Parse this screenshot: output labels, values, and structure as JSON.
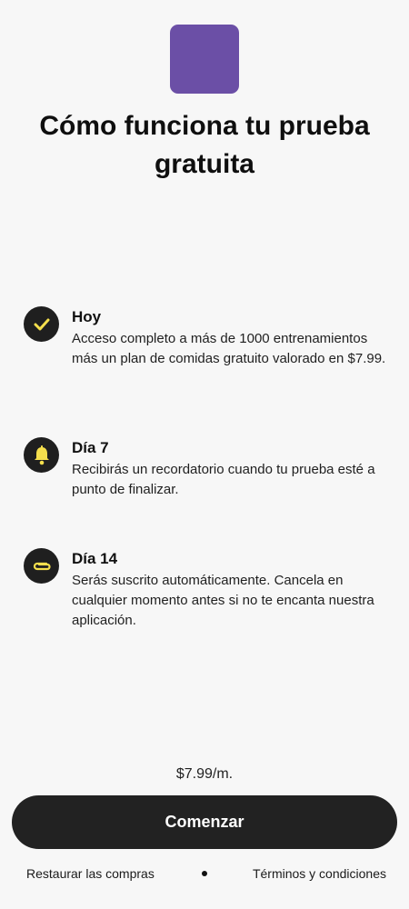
{
  "header": {
    "logo_color": "#6b4fa6",
    "title": "Cómo funciona tu prueba gratuita"
  },
  "timeline": [
    {
      "title": "Hoy",
      "text": "Acceso completo a más de 1000 entrenamientos más un plan de comidas gratuito valorado en $7.99.",
      "icon": "check-icon"
    },
    {
      "title": "Día 7",
      "text": "Recibirás un recordatorio cuando tu prueba esté a punto de finalizar.",
      "icon": "bell-icon"
    },
    {
      "title": "Día 14",
      "text": "Serás suscrito automáticamente. Cancela en cualquier momento antes si no te encanta nuestra aplicación.",
      "icon": "paperclip-icon"
    }
  ],
  "pricing": {
    "price": "$7.99/m."
  },
  "cta": {
    "label": "Comenzar"
  },
  "footer": {
    "restore_label": "Restaurar las compras",
    "terms_label": "Términos y condiciones"
  },
  "colors": {
    "accent_icon": "#f5df4d",
    "button_bg": "#222222",
    "background": "#f7f7f7"
  }
}
